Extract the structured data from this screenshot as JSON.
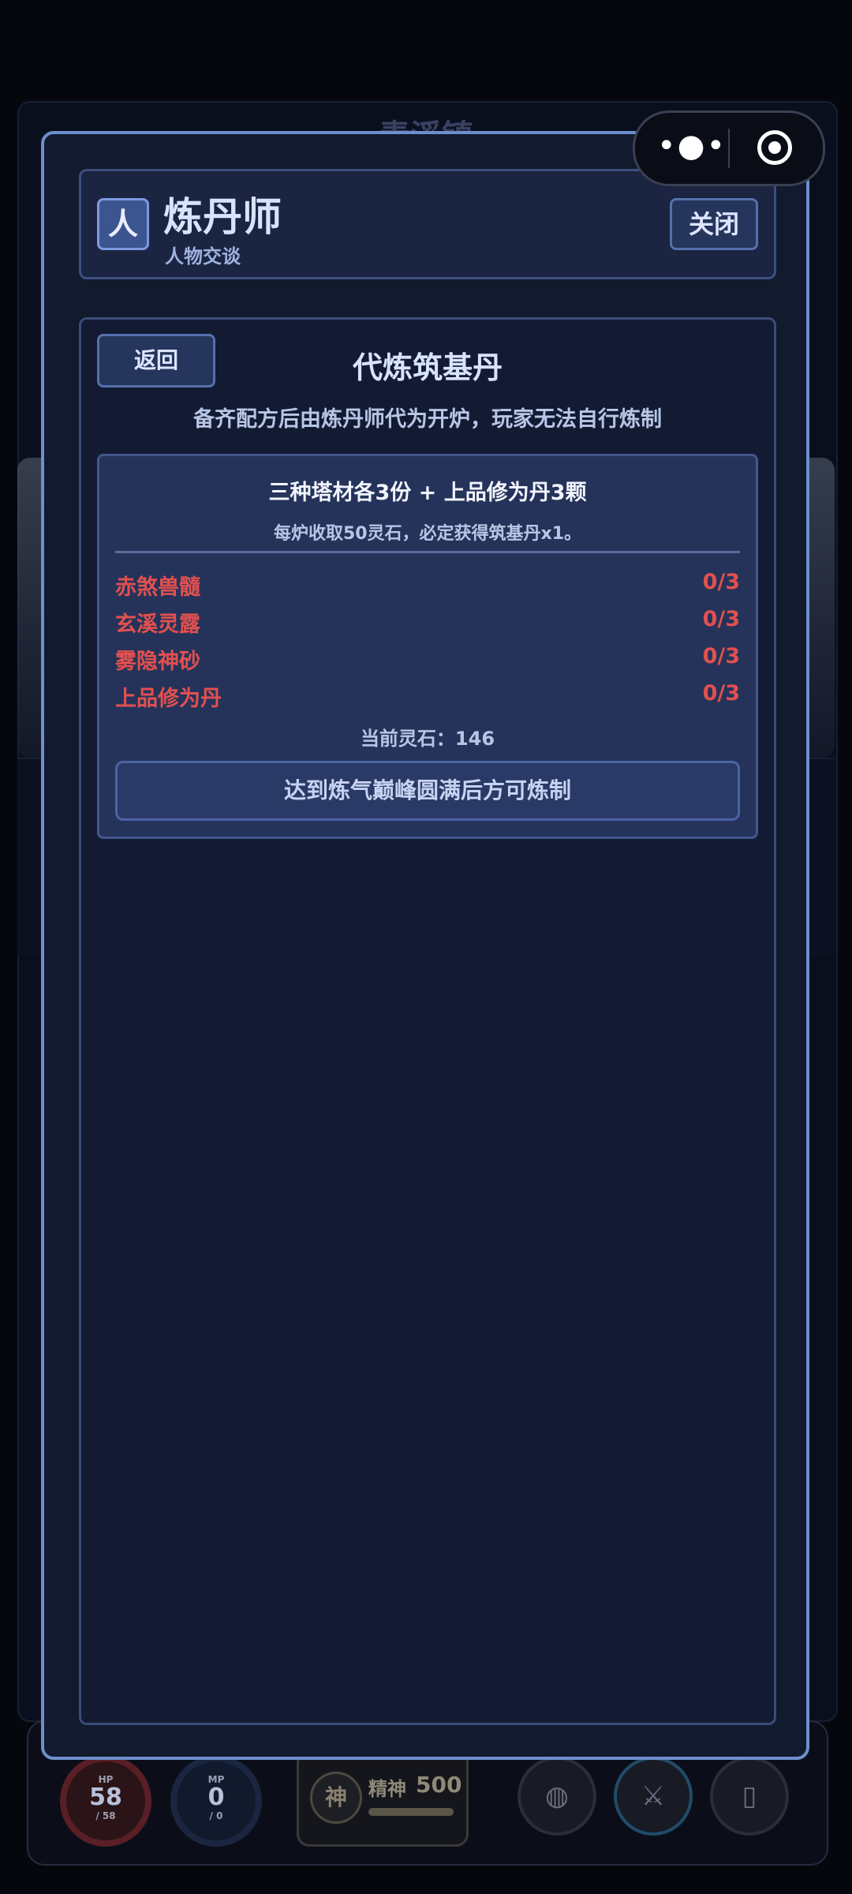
{
  "background": {
    "town_name": "青溪镇",
    "hud": {
      "hp": {
        "label": "HP",
        "value": "58",
        "max": "/ 58"
      },
      "mp": {
        "label": "MP",
        "value": "0",
        "max": "/ 0"
      },
      "spirit": {
        "icon_char": "神",
        "label": "精神",
        "value": "500"
      }
    }
  },
  "capsule": {
    "more_icon": "more-dots-icon",
    "close_icon": "target-circle-icon",
    "more_glyph": "•●•"
  },
  "dialog": {
    "avatar_char": "人",
    "npc_name": "炼丹师",
    "subtitle": "人物交谈",
    "close_label": "关闭",
    "back_label": "返回",
    "section_title": "代炼筑基丹",
    "section_desc": "备齐配方后由炼丹师代为开炉，玩家无法自行炼制",
    "recipe": {
      "title": "三种塔材各3份 + 上品修为丹3颗",
      "note": "每炉收取50灵石，必定获得筑基丹x1。",
      "materials": [
        {
          "name": "赤煞兽髓",
          "count": "0/3"
        },
        {
          "name": "玄溪灵露",
          "count": "0/3"
        },
        {
          "name": "雾隐神砂",
          "count": "0/3"
        },
        {
          "name": "上品修为丹",
          "count": "0/3"
        }
      ],
      "stones_text": "当前灵石：146",
      "craft_label": "达到炼气巅峰圆满后方可炼制"
    }
  },
  "colors": {
    "accent_border": "#6e8fcc",
    "missing_material": "#e2504f",
    "panel_bg": "#121a2e"
  }
}
